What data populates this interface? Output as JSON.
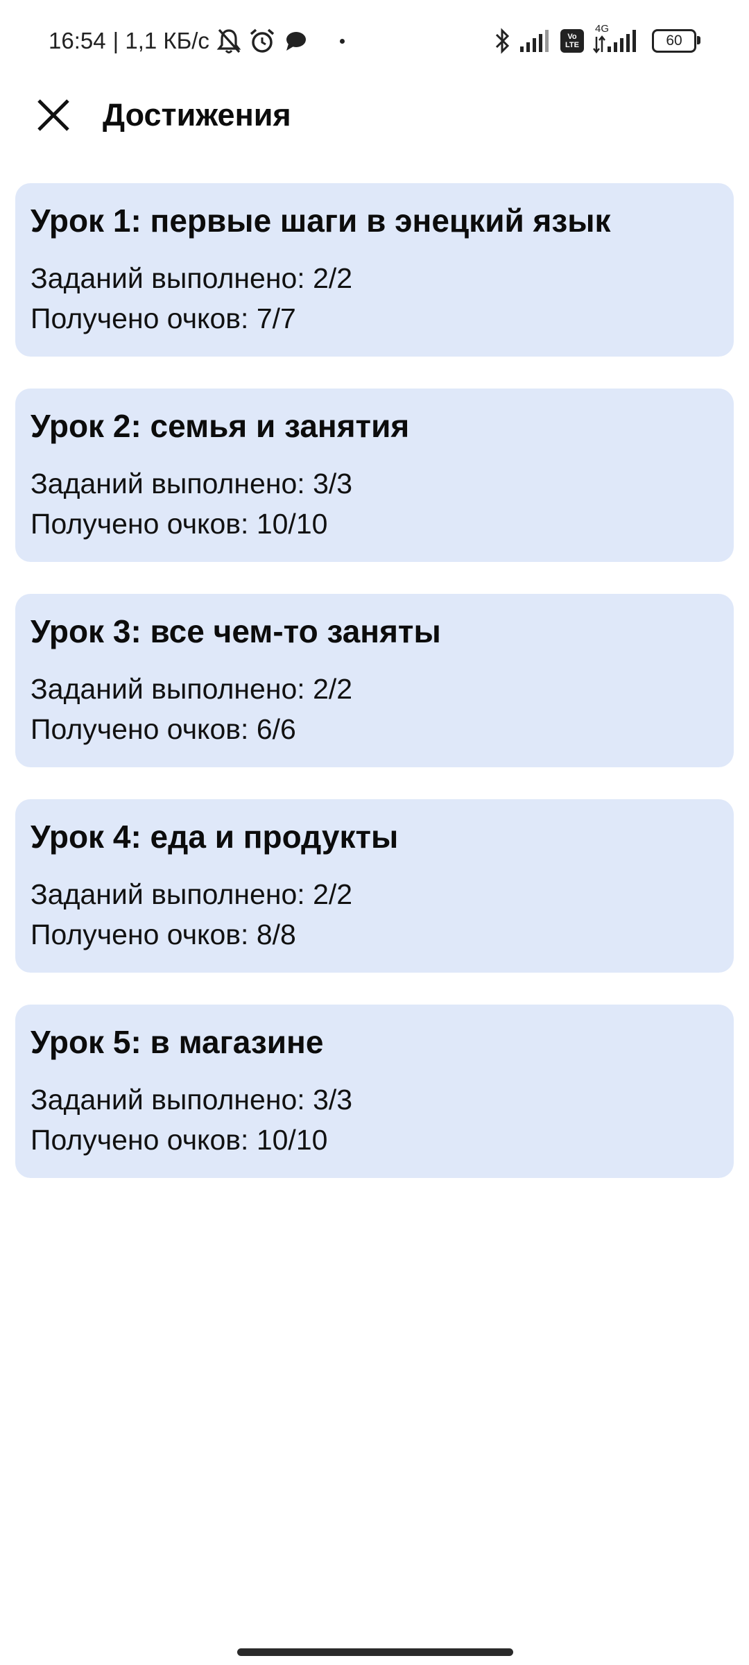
{
  "status_bar": {
    "time": "16:54",
    "speed": "| 1,1 КБ/с",
    "volte": "Vo LTE",
    "network": "4G",
    "battery": "60",
    "icons": [
      "bell-off-icon",
      "alarm-icon",
      "chat-bubble-icon",
      "bluetooth-icon",
      "signal-icon",
      "volte-icon",
      "signal-4g-icon",
      "battery-icon"
    ]
  },
  "header": {
    "title": "Достижения",
    "close_icon": "close-icon"
  },
  "lessons": [
    {
      "title": "Урок 1: первые шаги в энецкий язык",
      "tasks": "Заданий выполнено: 2/2",
      "points": "Получено очков: 7/7"
    },
    {
      "title": "Урок 2: семья и занятия",
      "tasks": "Заданий выполнено: 3/3",
      "points": "Получено очков: 10/10"
    },
    {
      "title": "Урок 3: все чем-то заняты",
      "tasks": "Заданий выполнено: 2/2",
      "points": "Получено очков: 6/6"
    },
    {
      "title": "Урок 4: еда и продукты",
      "tasks": "Заданий выполнено: 2/2",
      "points": "Получено очков: 8/8"
    },
    {
      "title": "Урок 5: в магазине",
      "tasks": "Заданий выполнено: 3/3",
      "points": "Получено очков: 10/10"
    }
  ],
  "colors": {
    "card_background": "#dfe8f9",
    "text": "#0c0c0c",
    "background": "#ffffff"
  }
}
